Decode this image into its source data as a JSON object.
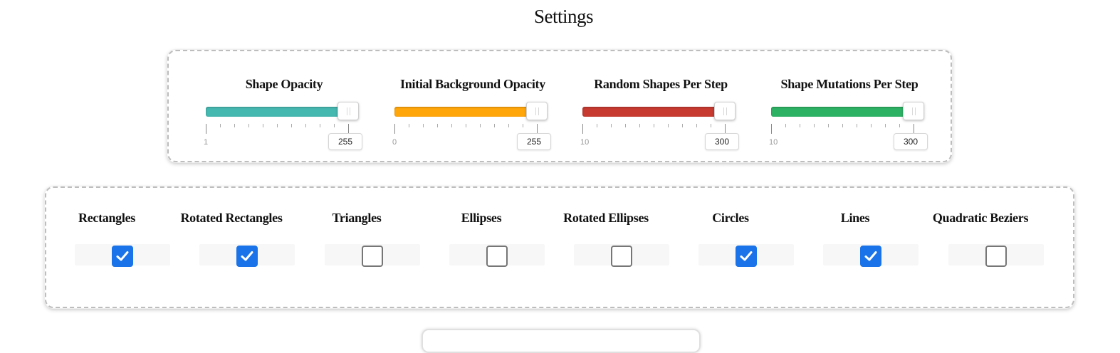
{
  "page": {
    "title": "Settings"
  },
  "sliders": [
    {
      "label": "Shape Opacity",
      "min": "1",
      "max": "255",
      "value": 1.0,
      "color": "#45b8b0"
    },
    {
      "label": "Initial Background Opacity",
      "min": "0",
      "max": "255",
      "value": 1.0,
      "color": "#ffa60a"
    },
    {
      "label": "Random Shapes Per Step",
      "min": "10",
      "max": "300",
      "value": 1.0,
      "color": "#c63a30"
    },
    {
      "label": "Shape Mutations Per Step",
      "min": "10",
      "max": "300",
      "value": 1.0,
      "color": "#2db264"
    }
  ],
  "shapes": [
    {
      "label": "Rectangles",
      "checked": true
    },
    {
      "label": "Rotated Rectangles",
      "checked": true
    },
    {
      "label": "Triangles",
      "checked": false
    },
    {
      "label": "Ellipses",
      "checked": false
    },
    {
      "label": "Rotated Ellipses",
      "checked": false
    },
    {
      "label": "Circles",
      "checked": true
    },
    {
      "label": "Lines",
      "checked": true
    },
    {
      "label": "Quadratic Beziers",
      "checked": false
    }
  ],
  "icons": {
    "check": "checkmark-icon",
    "handle": "grip-lines-icon"
  }
}
